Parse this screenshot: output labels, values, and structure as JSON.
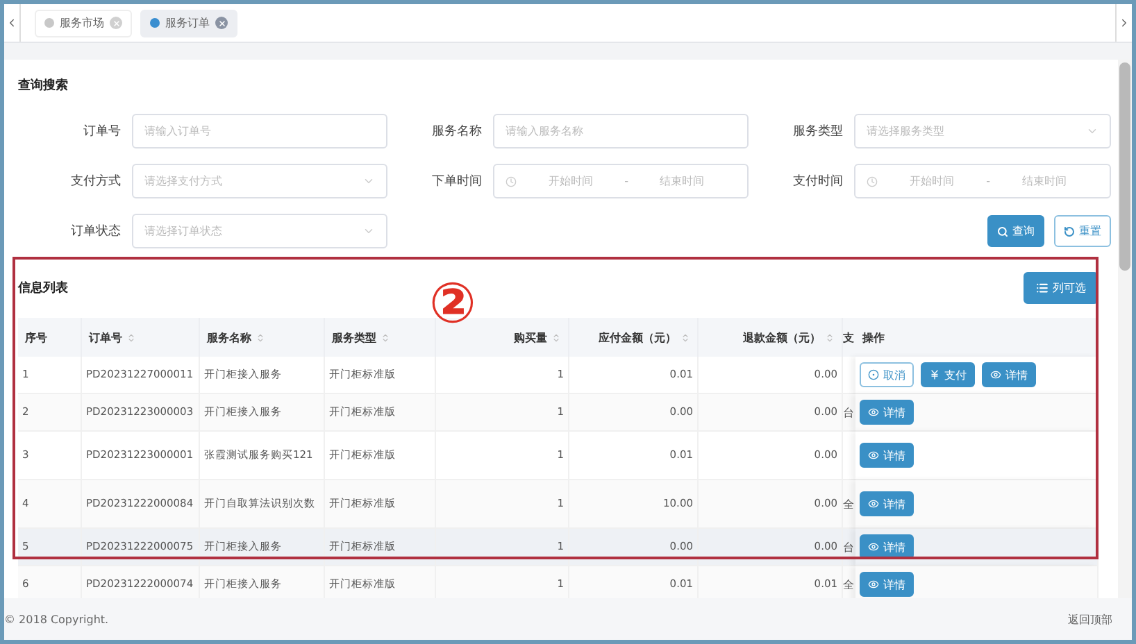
{
  "tabs": [
    {
      "label": "服务市场",
      "selected": false
    },
    {
      "label": "服务订单",
      "selected": true
    }
  ],
  "search": {
    "title": "查询搜索",
    "fields": [
      {
        "label": "订单号",
        "kind": "text",
        "placeholder": "请输入订单号"
      },
      {
        "label": "服务名称",
        "kind": "text",
        "placeholder": "请输入服务名称"
      },
      {
        "label": "服务类型",
        "kind": "select",
        "placeholder": "请选择服务类型"
      },
      {
        "label": "支付方式",
        "kind": "select",
        "placeholder": "请选择支付方式"
      },
      {
        "label": "下单时间",
        "kind": "range",
        "start": "开始时间",
        "separator": "-",
        "end": "结束时间"
      },
      {
        "label": "支付时间",
        "kind": "range",
        "start": "开始时间",
        "separator": "-",
        "end": "结束时间"
      },
      {
        "label": "订单状态",
        "kind": "select",
        "placeholder": "请选择订单状态"
      }
    ],
    "buttons": [
      {
        "label": "查询",
        "kind": "search"
      },
      {
        "label": "重置",
        "kind": "reset"
      }
    ]
  },
  "list": {
    "title": "信息列表",
    "column_button": "列可选",
    "annotation": "②",
    "columns": [
      {
        "label": "序号",
        "sortable": false
      },
      {
        "label": "订单号",
        "sortable": true
      },
      {
        "label": "服务名称",
        "sortable": true
      },
      {
        "label": "服务类型",
        "sortable": true
      },
      {
        "label": "购买量",
        "sortable": true
      },
      {
        "label": "应付金额（元）",
        "sortable": true
      },
      {
        "label": "退款金额（元）",
        "sortable": true
      },
      {
        "label": "支"
      },
      {
        "label": "操作",
        "sortable": false
      }
    ],
    "rows": [
      {
        "cells": [
          "1",
          "PD20231227000011",
          "开门柜接入服务",
          "开门柜标准版",
          "1",
          "0.01",
          "0.00",
          ""
        ],
        "highlighted": false,
        "actions": [
          {
            "label": "取消",
            "kind": "cancel"
          },
          {
            "label": "支付",
            "kind": "pay"
          },
          {
            "label": "详情",
            "kind": "detail"
          }
        ]
      },
      {
        "cells": [
          "2",
          "PD20231223000003",
          "开门柜接入服务",
          "开门柜标准版",
          "1",
          "0.00",
          "0.00",
          "台"
        ],
        "highlighted": false,
        "actions": [
          {
            "label": "详情",
            "kind": "detail"
          }
        ]
      },
      {
        "cells": [
          "3",
          "PD20231223000001",
          "张霞测试服务购买121",
          "开门柜标准版",
          "1",
          "0.01",
          "0.00",
          ""
        ],
        "highlighted": false,
        "actions": [
          {
            "label": "详情",
            "kind": "detail"
          }
        ]
      },
      {
        "cells": [
          "4",
          "PD20231222000084",
          "开门自取算法识别次数",
          "开门柜标准版",
          "1",
          "10.00",
          "0.00",
          "全"
        ],
        "highlighted": false,
        "actions": [
          {
            "label": "详情",
            "kind": "detail"
          }
        ]
      },
      {
        "cells": [
          "5",
          "PD20231222000075",
          "开门柜接入服务",
          "开门柜标准版",
          "1",
          "0.00",
          "0.00",
          "台"
        ],
        "highlighted": true,
        "actions": [
          {
            "label": "详情",
            "kind": "detail"
          }
        ]
      },
      {
        "cells": [
          "6",
          "PD20231222000074",
          "开门柜接入服务",
          "开门柜标准版",
          "1",
          "0.01",
          "0.01",
          "全"
        ],
        "highlighted": false,
        "actions": [
          {
            "label": "详情",
            "kind": "detail"
          }
        ]
      }
    ]
  },
  "footer": {
    "copyright": "© 2018 Copyright.",
    "back_to_top": "返回顶部"
  }
}
